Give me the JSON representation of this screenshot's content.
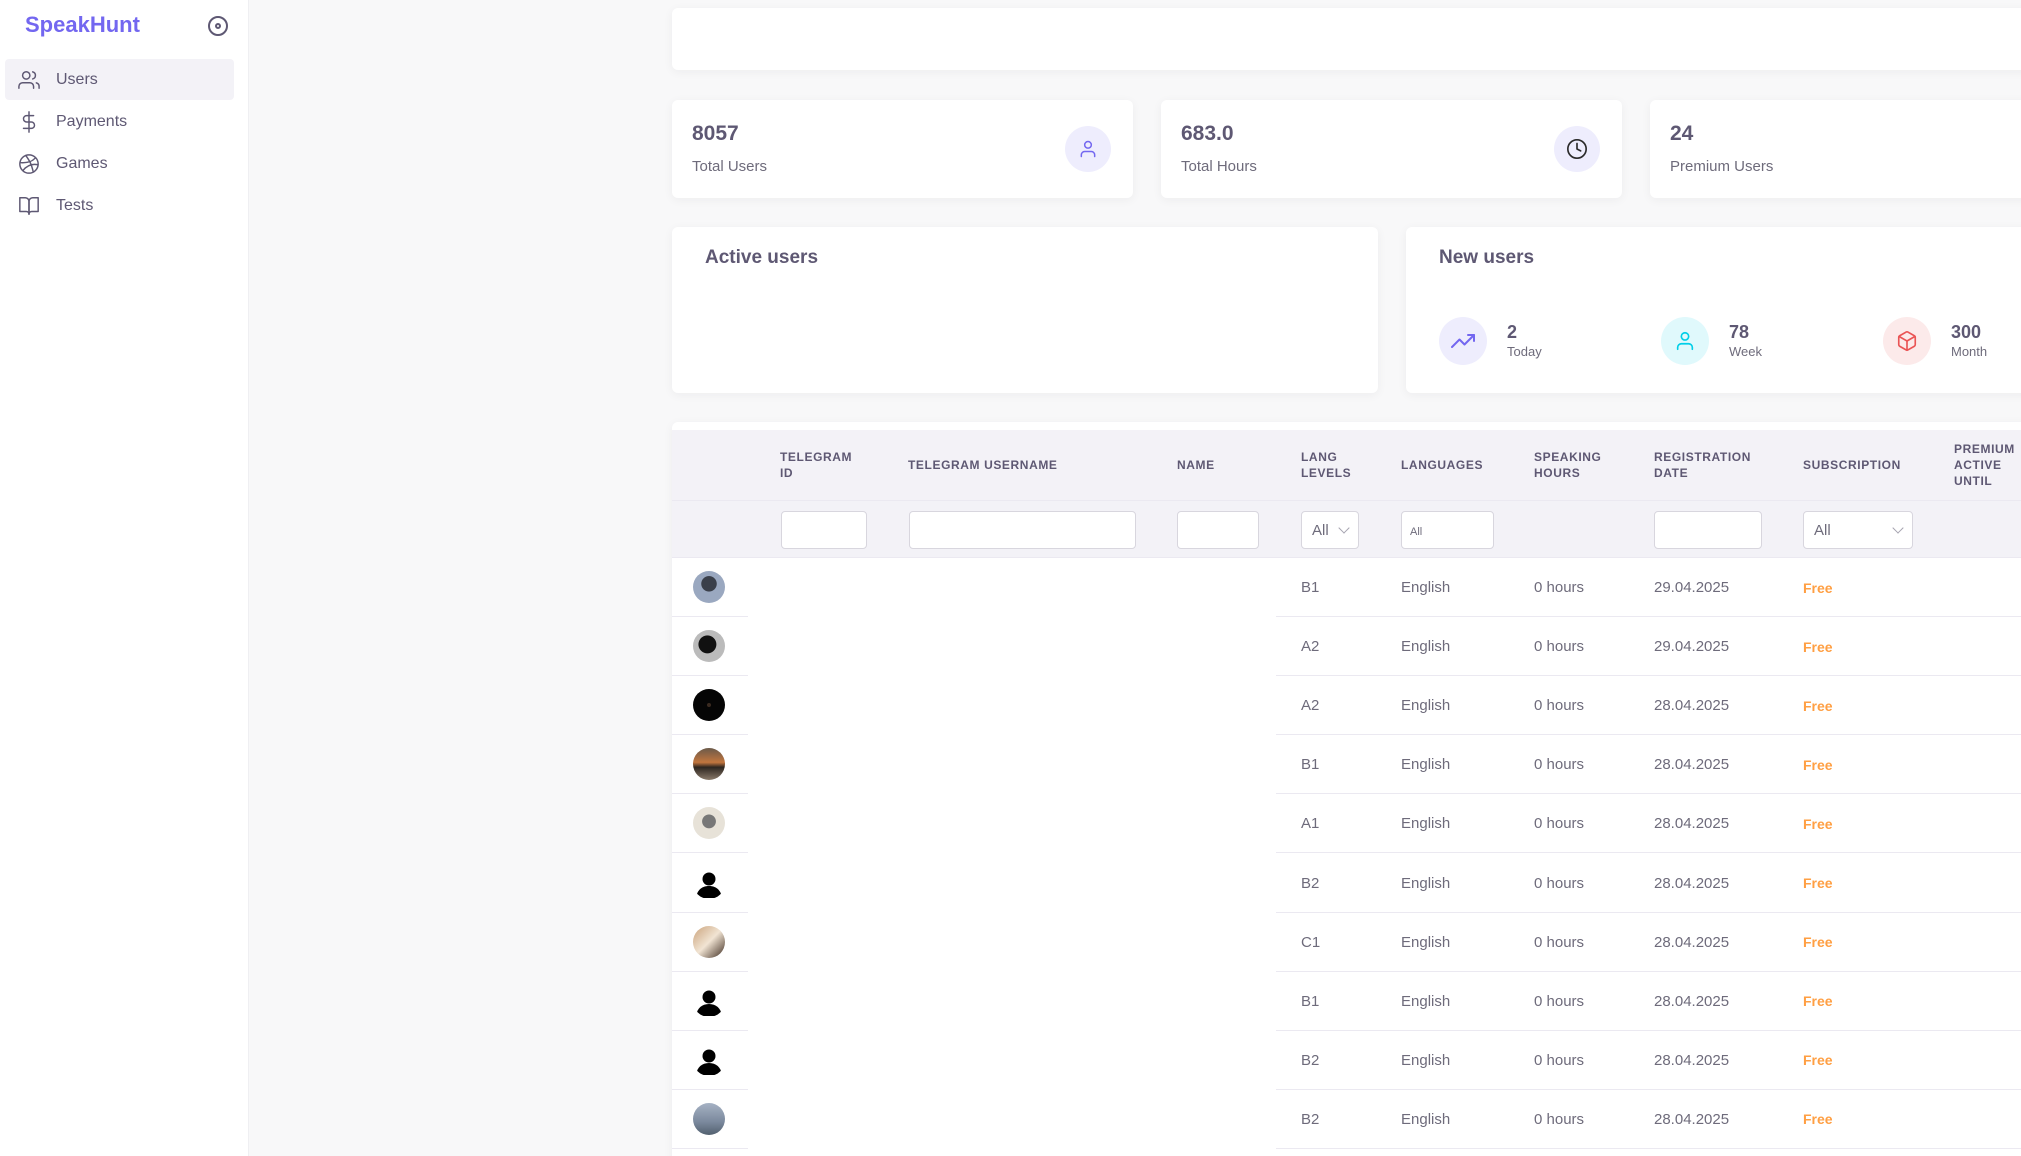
{
  "app": {
    "brand": "SpeakHunt"
  },
  "sidebar": {
    "items": [
      {
        "label": "Users",
        "icon": "users-icon",
        "active": true
      },
      {
        "label": "Payments",
        "icon": "dollar-icon",
        "active": false
      },
      {
        "label": "Games",
        "icon": "basketball-icon",
        "active": false
      },
      {
        "label": "Tests",
        "icon": "book-icon",
        "active": false
      }
    ]
  },
  "stats": [
    {
      "value": "8057",
      "label": "Total Users",
      "icon": "user-icon"
    },
    {
      "value": "683.0",
      "label": "Total Hours",
      "icon": "clock-icon"
    },
    {
      "value": "24",
      "label": "Premium Users",
      "icon": ""
    }
  ],
  "active_users": {
    "title": "Active users"
  },
  "new_users": {
    "title": "New users",
    "metrics": [
      {
        "value": "2",
        "label": "Today",
        "icon": "trending-up-icon"
      },
      {
        "value": "78",
        "label": "Week",
        "icon": "user-icon"
      },
      {
        "value": "300",
        "label": "Month",
        "icon": "box-icon"
      }
    ]
  },
  "table": {
    "columns": {
      "telegram_id": [
        "TELEGRAM",
        "ID"
      ],
      "telegram_username": "TELEGRAM USERNAME",
      "name": "NAME",
      "lang_levels": [
        "LANG",
        "LEVELS"
      ],
      "languages": "LANGUAGES",
      "speaking_hours": [
        "SPEAKING",
        "HOURS"
      ],
      "registration_date": [
        "REGISTRATION",
        "DATE"
      ],
      "subscription": "SUBSCRIPTION",
      "premium_active_until": [
        "PREMIUM",
        "ACTIVE",
        "UNTIL"
      ]
    },
    "filters": {
      "lang_levels_selected": "All",
      "languages_placeholder": "All",
      "subscription_selected": "All"
    },
    "rows": [
      {
        "level": "B1",
        "language": "English",
        "hours": "0 hours",
        "date": "29.04.2025",
        "subscription": "Free"
      },
      {
        "level": "A2",
        "language": "English",
        "hours": "0 hours",
        "date": "29.04.2025",
        "subscription": "Free"
      },
      {
        "level": "A2",
        "language": "English",
        "hours": "0 hours",
        "date": "28.04.2025",
        "subscription": "Free"
      },
      {
        "level": "B1",
        "language": "English",
        "hours": "0 hours",
        "date": "28.04.2025",
        "subscription": "Free"
      },
      {
        "level": "A1",
        "language": "English",
        "hours": "0 hours",
        "date": "28.04.2025",
        "subscription": "Free"
      },
      {
        "level": "B2",
        "language": "English",
        "hours": "0 hours",
        "date": "28.04.2025",
        "subscription": "Free"
      },
      {
        "level": "C1",
        "language": "English",
        "hours": "0 hours",
        "date": "28.04.2025",
        "subscription": "Free"
      },
      {
        "level": "B1",
        "language": "English",
        "hours": "0 hours",
        "date": "28.04.2025",
        "subscription": "Free"
      },
      {
        "level": "B2",
        "language": "English",
        "hours": "0 hours",
        "date": "28.04.2025",
        "subscription": "Free"
      },
      {
        "level": "B2",
        "language": "English",
        "hours": "0 hours",
        "date": "28.04.2025",
        "subscription": "Free"
      }
    ]
  },
  "colors": {
    "brand": "#7367f0",
    "free": "#ff9f43",
    "purple_tint": "#eeedfd",
    "cyan": "#00cfe8",
    "red": "#ea5455"
  }
}
